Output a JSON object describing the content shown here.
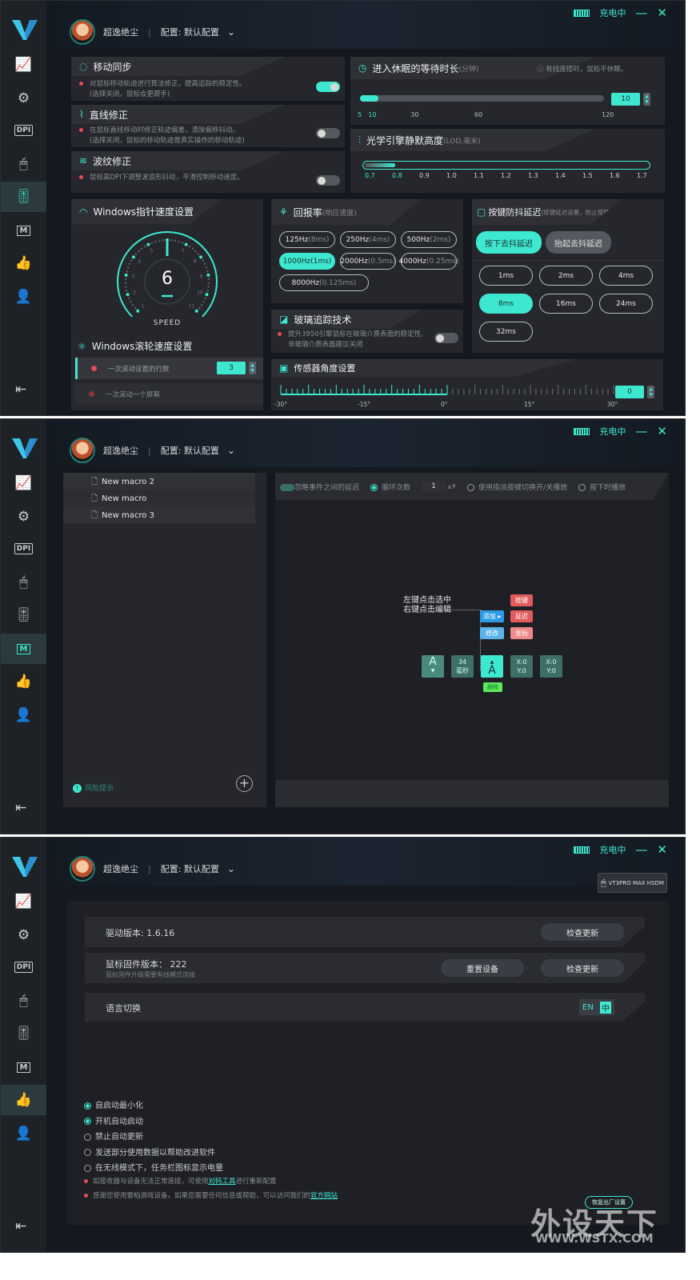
{
  "colors": {
    "accent": "#3ee8d0",
    "background": "#15181e",
    "card": "#25272c",
    "warning_dot": "#e84a5a"
  },
  "titlebar": {
    "battery_icon": "battery-icon",
    "status": "充电中",
    "minimize": "—",
    "close": "✕"
  },
  "header": {
    "username": "超逸绝尘",
    "separator": "|",
    "profile": "配置: 默认配置"
  },
  "sidebar": {
    "items": [
      {
        "icon": "chart-icon",
        "glyph": "📈"
      },
      {
        "icon": "monitor-gear-icon",
        "glyph": "⚙"
      },
      {
        "icon": "dpi-icon",
        "glyph": "DPI"
      },
      {
        "icon": "mouse-icon",
        "glyph": "🖱"
      },
      {
        "icon": "equalizer-icon",
        "glyph": "🎚"
      },
      {
        "icon": "macro-icon",
        "glyph": "M"
      },
      {
        "icon": "thumbs-up-icon",
        "glyph": "👍"
      },
      {
        "icon": "user-settings-icon",
        "glyph": "👤"
      }
    ],
    "collapse_glyph": "⇤"
  },
  "performance": {
    "motion_sync": {
      "title": "移动同步",
      "desc1": "对鼠标移动轨迹进行算法修正，提高追踪的稳定性。",
      "desc2": "(选择关闭，鼠标会更跟手)",
      "enabled": true
    },
    "angle_snap": {
      "title": "直线修正",
      "desc1": "在鼠标直线移动时修正轨迹偏差，清除偏移抖动。",
      "desc2": "(选择关闭，鼠标的移动轨迹是真实操作的移动轨迹)",
      "enabled": false
    },
    "ripple": {
      "title": "波纹修正",
      "desc1": "鼠标高DPI下调整波浪形抖动，平滑控制移动速度。",
      "enabled": false
    },
    "sleep": {
      "title": "进入休眠的等待时长",
      "unit": "(分钟)",
      "note": "有线连接时，鼠标不休眠。",
      "value": "10",
      "ticks": [
        "5",
        "10",
        "30",
        "60",
        "120"
      ],
      "min": 5,
      "max": 120
    },
    "lod": {
      "title": "光学引擎静默高度",
      "unit": "(LOD,毫米)",
      "ticks": [
        "0.7",
        "0.8",
        "0.9",
        "1.0",
        "1.1",
        "1.2",
        "1.3",
        "1.4",
        "1.5",
        "1.6",
        "1.7"
      ],
      "value": 0.8
    },
    "pointer_speed": {
      "title": "Windows指针速度设置",
      "value": "6",
      "label": "SPEED",
      "min": 1,
      "max": 11
    },
    "scroll": {
      "title": "Windows滚轮速度设置",
      "lines_label": "一次滚动设置的行数",
      "lines_value": "3",
      "screen_label": "一次滚动一个屏幕"
    },
    "polling": {
      "title": "回报率",
      "sub": "(响应速度)",
      "options": [
        {
          "hz": "125Hz",
          "ms": "(8ms)"
        },
        {
          "hz": "250Hz",
          "ms": "(4ms)"
        },
        {
          "hz": "500Hz",
          "ms": "(2ms)"
        },
        {
          "hz": "1000Hz",
          "ms": "(1ms)"
        },
        {
          "hz": "2000Hz",
          "ms": "(0.5ms)"
        },
        {
          "hz": "4000Hz",
          "ms": "(0.25ms)"
        },
        {
          "hz": "8000Hz",
          "ms": "(0.125ms)"
        }
      ],
      "selected": "1000Hz"
    },
    "glass": {
      "title": "玻璃追踪技术",
      "desc1": "提升3950引擎鼠标在玻璃介质表面的稳定性,",
      "desc2": "非玻璃介质表面建议关闭",
      "enabled": false
    },
    "debounce": {
      "title": "按键防抖延迟",
      "sub": "(按键延迟设置，防止按键误触双击)",
      "press": "按下去抖延迟",
      "release": "抬起去抖延迟",
      "options": [
        "1ms",
        "2ms",
        "4ms",
        "8ms",
        "16ms",
        "24ms",
        "32ms"
      ],
      "selected": "8ms"
    },
    "sensor_angle": {
      "title": "传感器角度设置",
      "ticks": [
        "-30°",
        "-15°",
        "0°",
        "15°",
        "30°"
      ],
      "value": "0",
      "min": -30,
      "max": 30
    }
  },
  "macro": {
    "list": [
      "New macro 2",
      "New macro",
      "New macro 3"
    ],
    "risk": "风险提示",
    "add": "+",
    "toolbar": {
      "ignore_delay": "忽略事件之间的延迟",
      "loop": "循环次数",
      "loop_count": "1",
      "toggle_play": "使用指派按键切换开/关播放",
      "hold_play": "按下时播放"
    },
    "hint1": "左键点击选中",
    "hint2": "右键点击编辑",
    "add_btn": "添加 ▸",
    "modify_btn": "修改",
    "menu": [
      "按键",
      "延迟",
      "坐标"
    ],
    "events": {
      "key_down": "A",
      "delay_value": "34",
      "delay_unit": "毫秒",
      "key_up": "A",
      "move1_x": "X:0",
      "move1_y": "Y:0",
      "move2_x": "X:0",
      "move2_y": "Y:0"
    },
    "delete": "删除"
  },
  "settings": {
    "device": "VT3PRO MAX HSDM",
    "driver": "驱动版本: 1.6.16",
    "check_update": "检查更新",
    "firmware": "鼠标固件版本： 222",
    "firmware_note": "鼠标固件升级需要有线模式连接",
    "reset_device": "重置设备",
    "language": "语言切换",
    "lang_en": "EN",
    "lang_zh": "中",
    "options": [
      {
        "label": "自启动最小化",
        "checked": true
      },
      {
        "label": "开机自动启动",
        "checked": true
      },
      {
        "label": "禁止自动更新",
        "checked": false
      },
      {
        "label": "发送部分使用数据以帮助改进软件",
        "checked": false
      },
      {
        "label": "在无线模式下，任务栏图标显示电量",
        "checked": false
      }
    ],
    "note1_a": "如接收器与设备无法正常连接，可使用",
    "note1_link": "对码工具",
    "note1_b": "进行重新配置",
    "note2_a": "感谢您使用雷柏游戏设备。如果您需要任何信息或帮助，可以访问我们的",
    "note2_link": "官方网站",
    "factory_reset": "恢复出厂设置"
  },
  "watermark": {
    "text": "外设天下",
    "url": "WWW.WSTX.COM"
  }
}
